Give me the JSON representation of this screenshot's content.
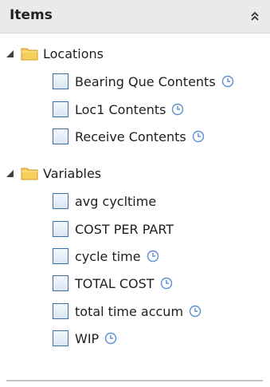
{
  "panel": {
    "title": "Items",
    "collapse_icon": "double-chevron-up-icon"
  },
  "groups": [
    {
      "label": "Locations",
      "expanded": true,
      "items": [
        {
          "label": "Bearing Que Contents",
          "checked": false,
          "clock": true
        },
        {
          "label": "Loc1 Contents",
          "checked": false,
          "clock": true
        },
        {
          "label": "Receive Contents",
          "checked": false,
          "clock": true
        }
      ]
    },
    {
      "label": "Variables",
      "expanded": true,
      "items": [
        {
          "label": "avg cycltime",
          "checked": false,
          "clock": false
        },
        {
          "label": "COST PER PART",
          "checked": false,
          "clock": false
        },
        {
          "label": "cycle time",
          "checked": false,
          "clock": true
        },
        {
          "label": "TOTAL COST",
          "checked": false,
          "clock": true
        },
        {
          "label": "total time accum",
          "checked": false,
          "clock": true
        },
        {
          "label": "WIP",
          "checked": false,
          "clock": true
        }
      ]
    }
  ],
  "colors": {
    "header_bg": "#eaeaea",
    "checkbox_border": "#3b6fa6",
    "folder_yellow": "#f5cf5a",
    "clock_blue": "#5b8fd0"
  }
}
